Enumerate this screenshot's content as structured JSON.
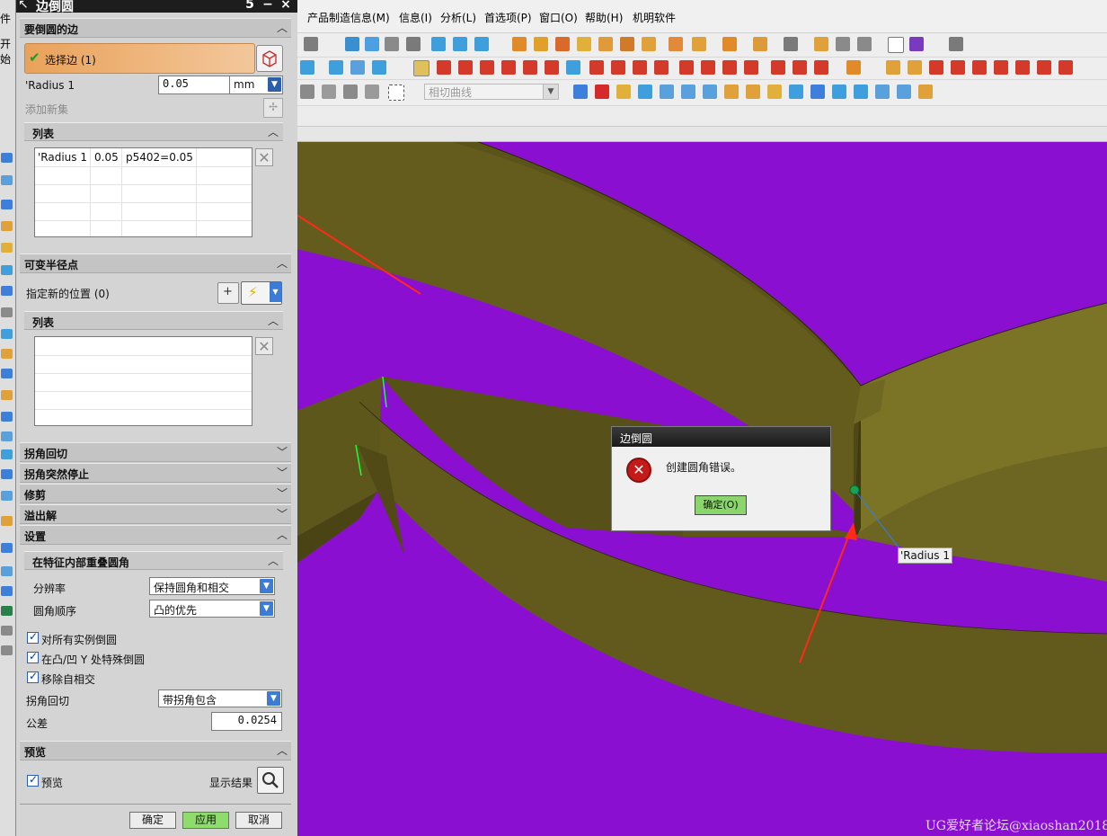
{
  "menubar": {
    "partial_left": "件",
    "items": [
      "产品制造信息(M)",
      "信息(I)",
      "分析(L)",
      "首选项(P)",
      "窗口(O)",
      "帮助(H)",
      "机明软件"
    ]
  },
  "toolbar": {
    "curve_combo_value": "相切曲线"
  },
  "left_strip": {
    "partial_label": "开始"
  },
  "dialog": {
    "title": "边倒圆",
    "title_buttons": [
      "5",
      "−",
      "×"
    ],
    "edges_section": {
      "header": "要倒圆的边",
      "select_edge_label": "选择边 (1)",
      "radius_label": "'Radius 1",
      "radius_value": "0.05",
      "radius_unit": "mm",
      "add_new_set": "添加新集"
    },
    "list_section": {
      "header": "列表",
      "rows": [
        [
          "'Radius 1",
          "0.05",
          "p5402=0.05"
        ]
      ]
    },
    "variable_radius": {
      "header": "可变半径点",
      "specify_location": "指定新的位置 (0)",
      "list_header": "列表"
    },
    "collapsed_sections": [
      "拐角回切",
      "拐角突然停止",
      "修剪",
      "溢出解"
    ],
    "settings": {
      "header": "设置",
      "sub_header": "在特征内部重叠圆角",
      "resolution_label": "分辨率",
      "resolution_value": "保持圆角和相交",
      "fillet_order_label": "圆角顺序",
      "fillet_order_value": "凸的优先",
      "cb_all_instances": "对所有实例倒圆",
      "cb_convex_concave": "在凸/凹 Y 处特殊倒圆",
      "cb_remove_self": "移除自相交",
      "corner_setback_label": "拐角回切",
      "corner_setback_value": "带拐角包含",
      "tolerance_label": "公差",
      "tolerance_value": "0.0254"
    },
    "preview": {
      "header": "预览",
      "cb_preview": "预览",
      "show_result": "显示结果"
    },
    "buttons": {
      "ok": "确定",
      "apply": "应用",
      "cancel": "取消"
    }
  },
  "viewport": {
    "radius_tag": "'Radius 1",
    "watermark": "UG爱好者论坛@xiaoshan2018"
  },
  "error_dialog": {
    "title": "边倒圆",
    "message": "创建圆角错误。",
    "ok_button": "确定(O)"
  },
  "colors": {
    "viewport_bg": "#8a0fd0",
    "solid_face": "#6b6420",
    "solid_face_light": "#7d7428",
    "annotation_arrow": "#ff2a1a",
    "select_bar": "#e9a25a"
  }
}
